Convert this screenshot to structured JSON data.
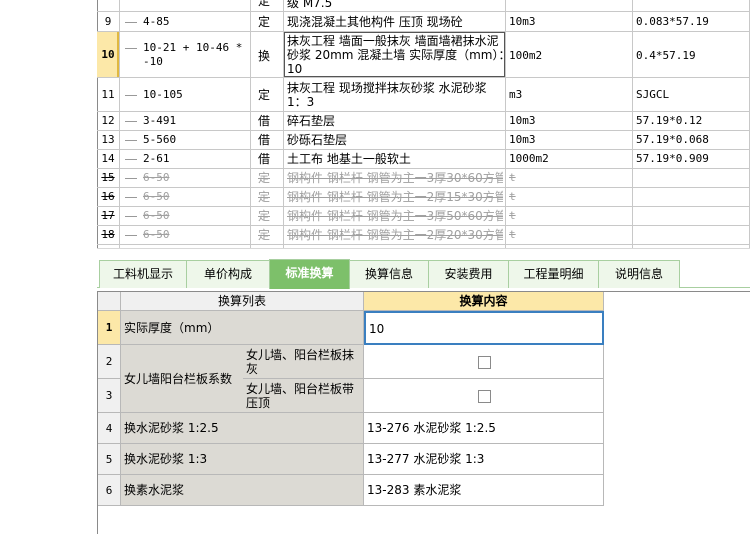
{
  "top_table": {
    "partial_row": {
      "unit_desc": "级 M7.5"
    },
    "rows": [
      {
        "num": "9",
        "code": "4-85",
        "type": "定",
        "name": "现浇混凝土其他构件 压顶 现场砼",
        "unit": "10m3",
        "expr": "0.083*57.19"
      },
      {
        "num": "10",
        "code": "10-21 + 10-46 * -10",
        "code_line1": "10-21 + 10-46 *",
        "code_line2": "-10",
        "type": "换",
        "name_line1": "抹灰工程 墙面一般抹灰 墙面墙裙抹水泥",
        "name_line2": "砂浆 20mm 混凝土墙  实际厚度（mm）：",
        "name_line3": "10",
        "unit": "100m2",
        "expr": "0.4*57.19"
      },
      {
        "num": "11",
        "code": "10-105",
        "type": "定",
        "name_line1": "抹灰工程 现场搅拌抹灰砂浆 水泥砂浆",
        "name_line2": "1：3",
        "unit": "m3",
        "expr": "SJGCL"
      },
      {
        "num": "12",
        "code": "3-491",
        "type": "借",
        "name": "碎石垫层",
        "unit": "10m3",
        "expr": "57.19*0.12"
      },
      {
        "num": "13",
        "code": "5-560",
        "type": "借",
        "name": "砂砾石垫层",
        "unit": "10m3",
        "expr": "57.19*0.068"
      },
      {
        "num": "14",
        "code": "2-61",
        "type": "借",
        "name": "土工布 地基土一般软土",
        "unit": "1000m2",
        "expr": "57.19*0.909"
      },
      {
        "num": "15",
        "code": "6-50",
        "type": "定",
        "name": "钢构件 钢栏杆 钢管为主一3厚30*60方管",
        "unit": "t",
        "expr": ""
      },
      {
        "num": "16",
        "code": "6-50",
        "type": "定",
        "name": "钢构件 钢栏杆 钢管为主一2厚15*30方管",
        "unit": "t",
        "expr": ""
      },
      {
        "num": "17",
        "code": "6-50",
        "type": "定",
        "name": "钢构件 钢栏杆 钢管为主一3厚50*60方管",
        "unit": "t",
        "expr": ""
      },
      {
        "num": "18",
        "code": "6-50",
        "type": "定",
        "name": "钢构件 钢栏杆 钢管为主一2厚20*30方管",
        "unit": "t",
        "expr": ""
      }
    ]
  },
  "tabs": [
    {
      "label": "工料机显示"
    },
    {
      "label": "单价构成"
    },
    {
      "label": "标准换算",
      "active": true
    },
    {
      "label": "换算信息"
    },
    {
      "label": "安装费用"
    },
    {
      "label": "工程量明细"
    },
    {
      "label": "说明信息"
    }
  ],
  "conversion": {
    "header_list": "换算列表",
    "header_content": "换算内容",
    "rows": [
      {
        "num": "1",
        "label": "实际厚度（mm）",
        "value": "10"
      },
      {
        "num": "2",
        "group": "女儿墙阳台栏板系数",
        "sub": "女儿墙、阳台栏板抹灰",
        "checked": false
      },
      {
        "num": "3",
        "sub": "女儿墙、阳台栏板带压顶",
        "checked": false
      },
      {
        "num": "4",
        "label": "换水泥砂浆 1:2.5",
        "value": "13-276  水泥砂浆 1:2.5"
      },
      {
        "num": "5",
        "label": "换水泥砂浆 1:3",
        "value": "13-277  水泥砂浆 1:3"
      },
      {
        "num": "6",
        "label": "换素水泥浆",
        "value": "13-283  素水泥浆"
      }
    ]
  },
  "colors": {
    "active_tab": "#7dc06a",
    "header_highlight": "#fce8a8",
    "selected_rownum": "#fce8a8"
  }
}
